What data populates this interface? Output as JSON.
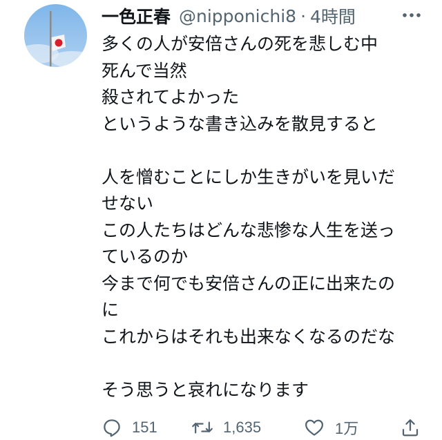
{
  "tweet": {
    "author": {
      "display_name": "一色正春",
      "handle": "@nipponichi8",
      "avatar_icon": "japan-flag-avatar"
    },
    "separator": "·",
    "time": "4時間",
    "text_lines": [
      "多くの人が安倍さんの死を悲しむ中",
      "死んで当然",
      "殺されてよかった",
      "というような書き込みを散見すると",
      "",
      "人を憎むことにしか生きがいを見いだ",
      "せない",
      "この人たちはどんな悲惨な人生を送っ",
      "ているのか",
      "今まで何でも安倍さんの正に出来たの",
      "に",
      "これからはそれも出来なくなるのだな",
      "",
      "そう思うと哀れになります"
    ],
    "actions": {
      "reply_count": "151",
      "retweet_count": "1,635",
      "like_count": "1万"
    },
    "icons": {
      "more": "more-icon",
      "reply": "reply-icon",
      "retweet": "retweet-icon",
      "like": "like-icon",
      "share": "share-icon"
    },
    "colors": {
      "text": "#0f1419",
      "secondary": "#536471"
    }
  }
}
